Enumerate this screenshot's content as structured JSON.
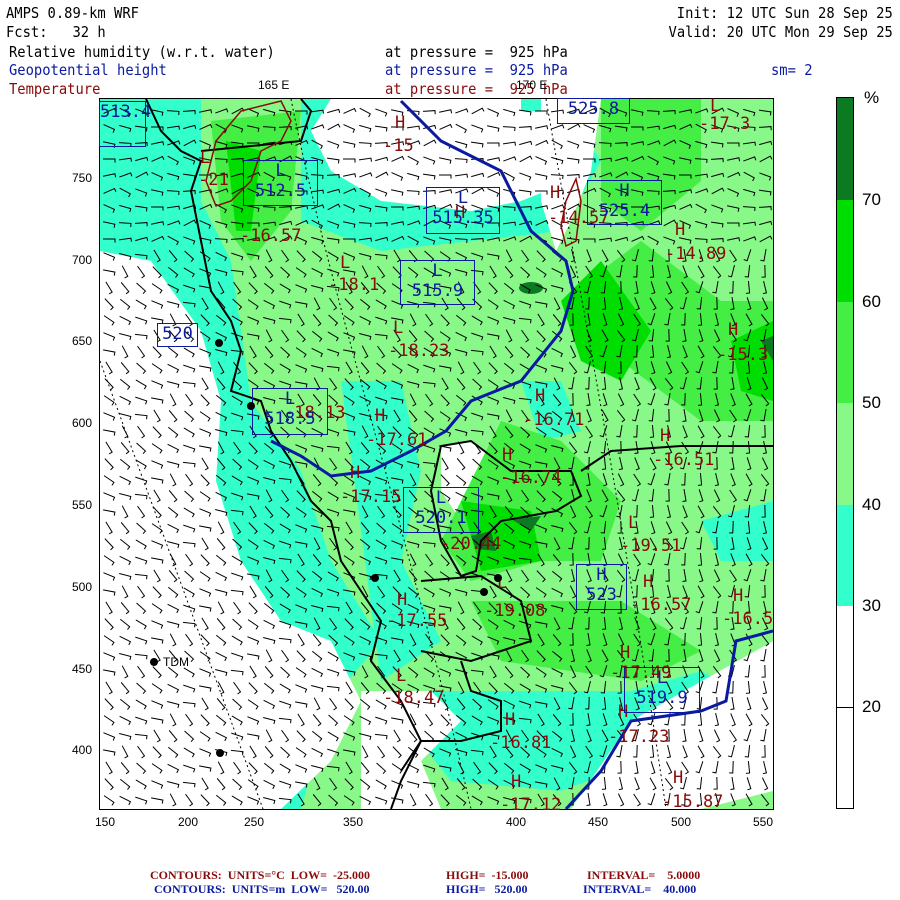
{
  "header": {
    "model": "AMPS 0.89-km WRF",
    "forecast": "Fcst:   32 h",
    "init": "Init: 12 UTC Sun 28 Sep 25",
    "valid": "Valid: 20 UTC Mon 29 Sep 25",
    "fields": [
      {
        "name": "Relative humidity (w.r.t. water)",
        "level": "at pressure =  925 hPa",
        "color": "#000000"
      },
      {
        "name": "Geopotential height",
        "level": "at pressure =  925 hPa",
        "color": "#0a1aa0"
      },
      {
        "name": "Temperature",
        "level": "at pressure =  925 hPa",
        "color": "#8a0a0a"
      }
    ],
    "smoothing": "sm= 2"
  },
  "longitude_labels": [
    "165 E",
    "170 E"
  ],
  "axes": {
    "x_ticks": [
      "150",
      "200",
      "250",
      "300",
      "350",
      "400",
      "450",
      "500",
      "550"
    ],
    "y_ticks": [
      "750",
      "700",
      "650",
      "600",
      "550",
      "500",
      "450",
      "400"
    ]
  },
  "colorbar": {
    "unit": "%",
    "levels": [
      "70",
      "60",
      "50",
      "40",
      "30",
      "20"
    ],
    "colors": [
      "#0c7a20",
      "#00dd00",
      "#44ee44",
      "#88f888",
      "#33ffcc",
      "#ffffff",
      "#ffffff"
    ]
  },
  "stations": [
    {
      "name": "TDM"
    }
  ],
  "temperature_labels": [
    {
      "type": "L",
      "value": "-21"
    },
    {
      "type": "H",
      "value": "-16.57"
    },
    {
      "type": "H",
      "value": "-15"
    },
    {
      "type": "L",
      "value": "-18.1"
    },
    {
      "type": "L",
      "value": "-18.23"
    },
    {
      "type": "H",
      "value": "-17.61"
    },
    {
      "type": "H",
      "value": "-17.15"
    },
    {
      "type": "H",
      "value": "-16.71"
    },
    {
      "type": "H",
      "value": "-16.74"
    },
    {
      "type": "H",
      "value": "-16.51"
    },
    {
      "type": "L",
      "value": "-20.44"
    },
    {
      "type": "L",
      "value": "-19.51"
    },
    {
      "type": "H",
      "value": "-16.57"
    },
    {
      "type": "H",
      "value": "-16.5"
    },
    {
      "type": "L",
      "value": "-19.08"
    },
    {
      "type": "H",
      "value": "-17.55"
    },
    {
      "type": "H",
      "value": "-17.49"
    },
    {
      "type": "L",
      "value": "-18.47"
    },
    {
      "type": "H",
      "value": "-16.81"
    },
    {
      "type": "H",
      "value": "-17.23"
    },
    {
      "type": "H",
      "value": "-17.12"
    },
    {
      "type": "H",
      "value": "-15.87"
    },
    {
      "type": "H",
      "value": "-14.57"
    },
    {
      "type": "H",
      "value": "-14.89"
    },
    {
      "type": "H",
      "value": "-15.3"
    },
    {
      "type": "L",
      "value": "-17.3"
    },
    {
      "type": "L",
      "value": "-18.13"
    }
  ],
  "height_labels": [
    {
      "type": "L",
      "value": "512.5"
    },
    {
      "type": "L",
      "value": "515.35"
    },
    {
      "type": "",
      "value": "525.8"
    },
    {
      "type": "H",
      "value": "525.4"
    },
    {
      "type": "L",
      "value": "515.9"
    },
    {
      "type": "",
      "value": "520"
    },
    {
      "type": "L",
      "value": "518.5"
    },
    {
      "type": "L",
      "value": "520.1"
    },
    {
      "type": "H",
      "value": "523"
    },
    {
      "type": "L",
      "value": "519.9"
    },
    {
      "type": "",
      "value": "513.4"
    }
  ],
  "footer": {
    "temperature": {
      "label": "CONTOURS:  UNITS=°C  LOW=  -25.000",
      "high": "HIGH=  -15.000",
      "interval": "INTERVAL=    5.0000"
    },
    "height": {
      "label": "CONTOURS:  UNITS=m  LOW=   520.00",
      "high": "HIGH=   520.00",
      "interval": "INTERVAL=    40.000"
    }
  }
}
